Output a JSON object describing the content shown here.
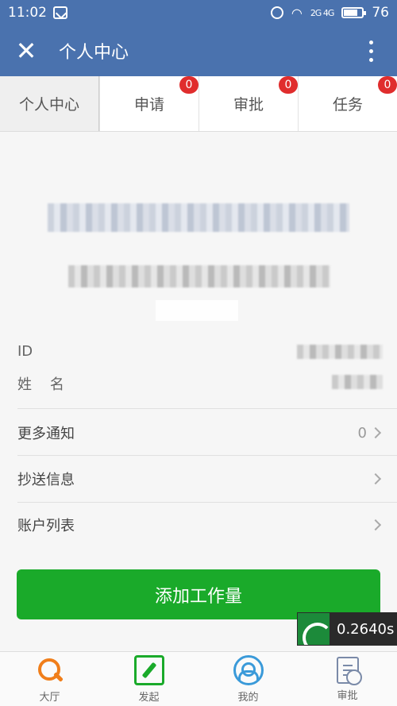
{
  "status_bar": {
    "time": "11:02",
    "battery": "76",
    "battery_level": 0.76,
    "signal": "2G 4G"
  },
  "header": {
    "title": "个人中心"
  },
  "tabs": [
    {
      "label": "个人中心",
      "badge": ""
    },
    {
      "label": "申请",
      "badge": "0"
    },
    {
      "label": "审批",
      "badge": "0"
    },
    {
      "label": "任务",
      "badge": "0"
    }
  ],
  "profile": {
    "id_label": "ID",
    "name_label": "姓    名"
  },
  "menu": [
    {
      "label": "更多通知",
      "count": "0"
    },
    {
      "label": "抄送信息",
      "count": ""
    },
    {
      "label": "账户列表",
      "count": ""
    }
  ],
  "actions": {
    "add_workload": "添加工作量"
  },
  "timer": {
    "value": "0.2640s"
  },
  "bottom_nav": [
    {
      "label": "大厅",
      "icon": "search-icon",
      "color": "#f07e1a"
    },
    {
      "label": "发起",
      "icon": "edit-icon",
      "color": "#1aaa2a"
    },
    {
      "label": "我的",
      "icon": "user-icon",
      "color": "#3a9ad9"
    },
    {
      "label": "审批",
      "icon": "approve-icon",
      "color": "#7a8aa8"
    }
  ],
  "colors": {
    "header_bg": "#4a72ae",
    "primary_button": "#1aaa2a",
    "badge": "#e02d2d"
  }
}
